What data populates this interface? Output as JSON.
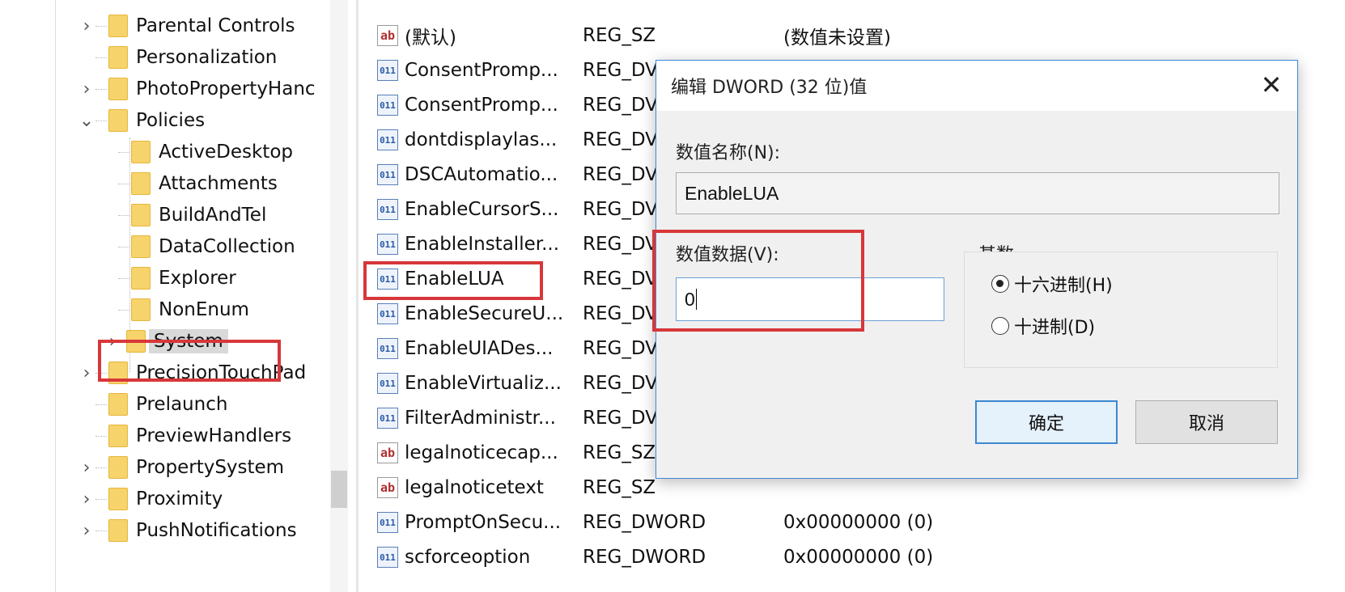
{
  "tree": {
    "items": [
      {
        "label": "Parental Controls",
        "expander": "›"
      },
      {
        "label": "Personalization",
        "expander": ""
      },
      {
        "label": "PhotoPropertyHanc",
        "expander": "›"
      },
      {
        "label": "Policies",
        "expander": "⌄"
      },
      {
        "label": "ActiveDesktop",
        "expander": ""
      },
      {
        "label": "Attachments",
        "expander": ""
      },
      {
        "label": "BuildAndTel",
        "expander": ""
      },
      {
        "label": "DataCollection",
        "expander": ""
      },
      {
        "label": "Explorer",
        "expander": ""
      },
      {
        "label": "NonEnum",
        "expander": ""
      },
      {
        "label": "System",
        "expander": "›"
      },
      {
        "label": "PrecisionTouchPad",
        "expander": "›"
      },
      {
        "label": "Prelaunch",
        "expander": ""
      },
      {
        "label": "PreviewHandlers",
        "expander": ""
      },
      {
        "label": "PropertySystem",
        "expander": "›"
      },
      {
        "label": "Proximity",
        "expander": "›"
      },
      {
        "label": "PushNotifications",
        "expander": "›"
      }
    ]
  },
  "values": {
    "rows": [
      {
        "icon": "ab",
        "name": "(默认)",
        "type": "REG_SZ",
        "data": "(数值未设置)"
      },
      {
        "icon": "011",
        "name": "ConsentPromp...",
        "type": "REG_DV",
        "data": ""
      },
      {
        "icon": "011",
        "name": "ConsentPromp...",
        "type": "REG_DV",
        "data": ""
      },
      {
        "icon": "011",
        "name": "dontdisplaylas...",
        "type": "REG_DV",
        "data": ""
      },
      {
        "icon": "011",
        "name": "DSCAutomatio...",
        "type": "REG_DV",
        "data": ""
      },
      {
        "icon": "011",
        "name": "EnableCursorS...",
        "type": "REG_DV",
        "data": ""
      },
      {
        "icon": "011",
        "name": "EnableInstaller...",
        "type": "REG_DV",
        "data": ""
      },
      {
        "icon": "011",
        "name": "EnableLUA",
        "type": "REG_DV",
        "data": ""
      },
      {
        "icon": "011",
        "name": "EnableSecureU...",
        "type": "REG_DV",
        "data": ""
      },
      {
        "icon": "011",
        "name": "EnableUIADes...",
        "type": "REG_DV",
        "data": ""
      },
      {
        "icon": "011",
        "name": "EnableVirtualiz...",
        "type": "REG_DV",
        "data": ""
      },
      {
        "icon": "011",
        "name": "FilterAdministr...",
        "type": "REG_DV",
        "data": ""
      },
      {
        "icon": "ab",
        "name": "legalnoticecap...",
        "type": "REG_SZ",
        "data": ""
      },
      {
        "icon": "ab",
        "name": "legalnoticetext",
        "type": "REG_SZ",
        "data": ""
      },
      {
        "icon": "011",
        "name": "PromptOnSecu...",
        "type": "REG_DWORD",
        "data": "0x00000000 (0)"
      },
      {
        "icon": "011",
        "name": "scforceoption",
        "type": "REG_DWORD",
        "data": "0x00000000 (0)"
      }
    ]
  },
  "dialog": {
    "title": "编辑 DWORD (32 位)值",
    "close_glyph": "✕",
    "name_label": "数值名称(N):",
    "name_value": "EnableLUA",
    "data_label": "数值数据(V):",
    "data_value": "0",
    "base_label": "基数",
    "radio_hex": "十六进制(H)",
    "radio_dec": "十进制(D)",
    "selected_base": "hex",
    "ok": "确定",
    "cancel": "取消"
  },
  "colors": {
    "highlight": "#d7373a",
    "accent": "#3c87d0",
    "folder": "#f7d36c"
  },
  "icons": {
    "folder": "folder-icon",
    "string_value": "reg-sz-icon",
    "dword_value": "reg-dword-icon",
    "close": "close-icon"
  }
}
